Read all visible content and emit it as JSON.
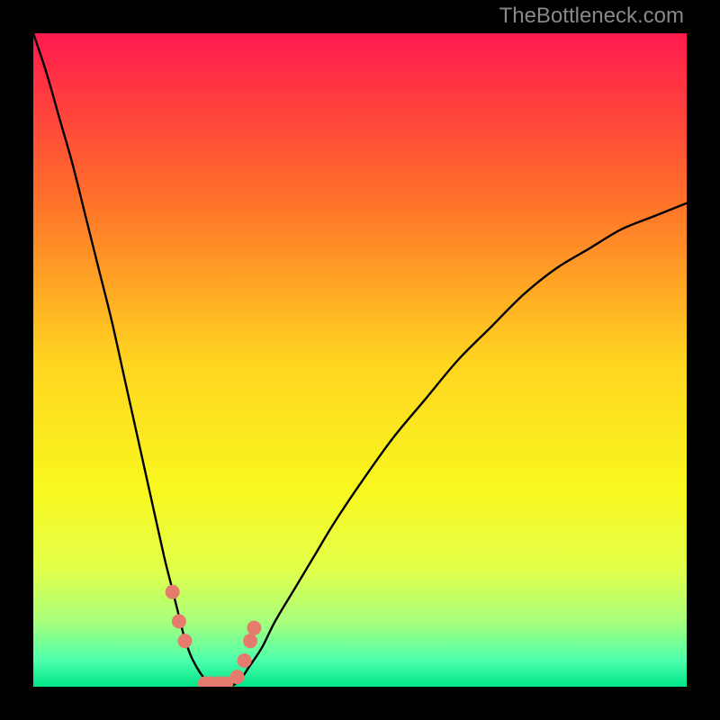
{
  "watermark": "TheBottleneck.com",
  "chart_data": {
    "type": "line",
    "title": "",
    "xlabel": "",
    "ylabel": "",
    "xlim": [
      0,
      100
    ],
    "ylim": [
      0,
      100
    ],
    "grid": false,
    "background_gradient": {
      "stops": [
        {
          "offset": 0.0,
          "color": "#ff1a4e"
        },
        {
          "offset": 0.25,
          "color": "#ff6f2a"
        },
        {
          "offset": 0.5,
          "color": "#ffd420"
        },
        {
          "offset": 0.7,
          "color": "#f8f81e"
        },
        {
          "offset": 0.82,
          "color": "#e2ff4a"
        },
        {
          "offset": 0.9,
          "color": "#a8ff7c"
        },
        {
          "offset": 0.96,
          "color": "#4dffac"
        },
        {
          "offset": 1.0,
          "color": "#00e588"
        }
      ]
    },
    "series": [
      {
        "name": "bottleneck-curve",
        "color": "#000000",
        "x": [
          0,
          2,
          4,
          6,
          8,
          10,
          12,
          14,
          16,
          18,
          20,
          21,
          22,
          23,
          24,
          25,
          26,
          27,
          28,
          29,
          30,
          31,
          32,
          33,
          35,
          37,
          40,
          43,
          46,
          50,
          55,
          60,
          65,
          70,
          75,
          80,
          85,
          90,
          95,
          100
        ],
        "y": [
          100,
          94,
          87,
          80,
          72,
          64,
          56,
          47,
          38,
          29,
          20,
          16,
          12,
          8,
          5,
          3,
          1.5,
          0.5,
          0,
          0,
          0,
          0.5,
          1.5,
          3,
          6,
          10,
          15,
          20,
          25,
          31,
          38,
          44,
          50,
          55,
          60,
          64,
          67,
          70,
          72,
          74
        ]
      }
    ],
    "markers": {
      "name": "points",
      "color": "#e47b6d",
      "radius_px": 8,
      "x": [
        21.3,
        22.3,
        23.2,
        26.3,
        27.2,
        28.3,
        29.5,
        31.2,
        32.3,
        33.2,
        33.8
      ],
      "y": [
        14.5,
        10,
        7,
        0.5,
        0.5,
        0.5,
        0.5,
        1.5,
        4,
        7,
        9
      ]
    }
  }
}
